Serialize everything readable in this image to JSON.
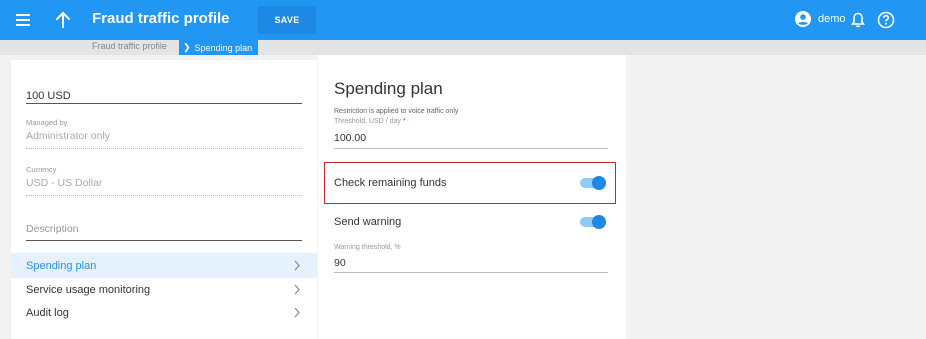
{
  "header": {
    "title": "Fraud traffic profile",
    "save_label": "SAVE",
    "user_name": "demo"
  },
  "breadcrumb": {
    "items": [
      {
        "label": "Fraud traffic profile"
      },
      {
        "label": "Spending plan"
      }
    ]
  },
  "left": {
    "name_value": "100 USD",
    "managed_by_label": "Managed by",
    "managed_by_value": "Administrator only",
    "currency_label": "Currency",
    "currency_value": "USD - US Dollar",
    "description_placeholder": "Description",
    "nav": [
      {
        "label": "Spending plan",
        "active": true
      },
      {
        "label": "Service usage monitoring",
        "active": false
      },
      {
        "label": "Audit log",
        "active": false
      }
    ]
  },
  "spending_plan": {
    "title": "Spending plan",
    "hint": "Restriction is applied to voice traffic only",
    "threshold_label": "Threshold, USD / day",
    "threshold_required_mark": "*",
    "threshold_value": "100.00",
    "check_remaining_funds_label": "Check remaining funds",
    "check_remaining_funds_on": true,
    "send_warning_label": "Send warning",
    "send_warning_on": true,
    "warning_threshold_label": "Warning threshold, %",
    "warning_threshold_value": "90"
  },
  "colors": {
    "primary": "#2196f3",
    "highlight_border": "#c62828",
    "active_nav_bg": "#e5f1fc"
  }
}
